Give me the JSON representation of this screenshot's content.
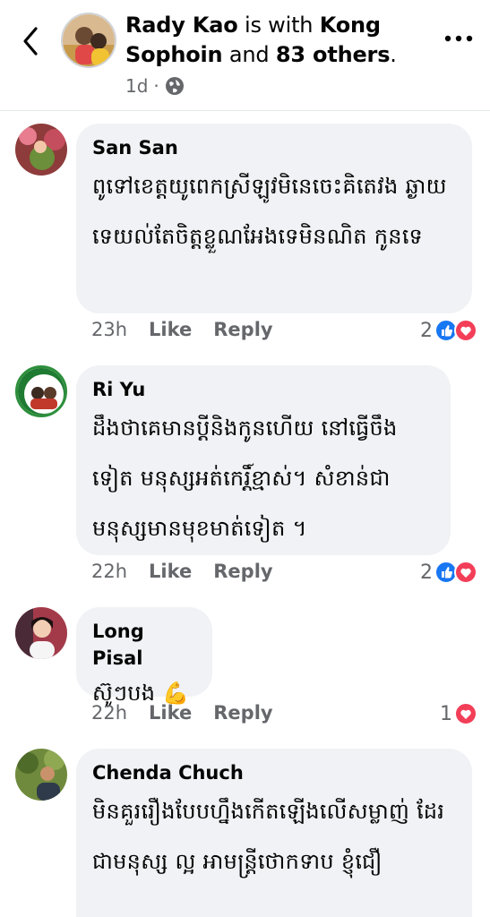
{
  "header": {
    "author": "Rady Kao",
    "with_text": " is with ",
    "tagged": "Kong Sophoin",
    "and_text": " and ",
    "others": "83 others",
    "period": ".",
    "time": "1d",
    "dot": "·",
    "icons": {
      "back": "chevron-left-icon",
      "privacy": "globe-icon",
      "more": "more-dots-icon"
    }
  },
  "comments": [
    {
      "name": "San San",
      "text": "ពូទៅខេត្តយូពេកស្រីឡូវមិនេចេះគិតេវង ឆ្ងាយទេយល់តែចិត្តខ្លួណអែងទេមិនណិត កូនទេ",
      "time": "23h",
      "like": "Like",
      "reply": "Reply",
      "reaction_count": "2",
      "reactions": [
        "like",
        "love"
      ]
    },
    {
      "name": "Ri Yu",
      "text": "ដឹងថាគេមានប្តីនិងកូនហើយ នៅធ្វើចឹង ទៀត មនុស្សអត់កេរ្តិ៍ខ្មាស់។ សំខាន់ជា មនុស្សមានមុខមាត់ទៀត ។",
      "time": "22h",
      "like": "Like",
      "reply": "Reply",
      "reaction_count": "2",
      "reactions": [
        "like",
        "love"
      ]
    },
    {
      "name": "Long Pisal",
      "text": "ស៊ូៗបង 💪",
      "time": "22h",
      "like": "Like",
      "reply": "Reply",
      "reaction_count": "1",
      "reactions": [
        "love"
      ]
    },
    {
      "name": "Chenda Chuch",
      "text": "មិនគួររឿងបែបហ្នឹងកើតឡើងលើសម្លាញ់ ដែរជាមនុស្ស ល្អ អាមន្ត្រីថោកទាប ខ្ញុំជឿ",
      "time": "",
      "like": "",
      "reply": "",
      "reaction_count": "",
      "reactions": []
    }
  ],
  "colors": {
    "like_blue": "#1877f2",
    "love_red": "#f33e58",
    "bubble": "#f0f2f5",
    "secondary_text": "#65676b"
  }
}
